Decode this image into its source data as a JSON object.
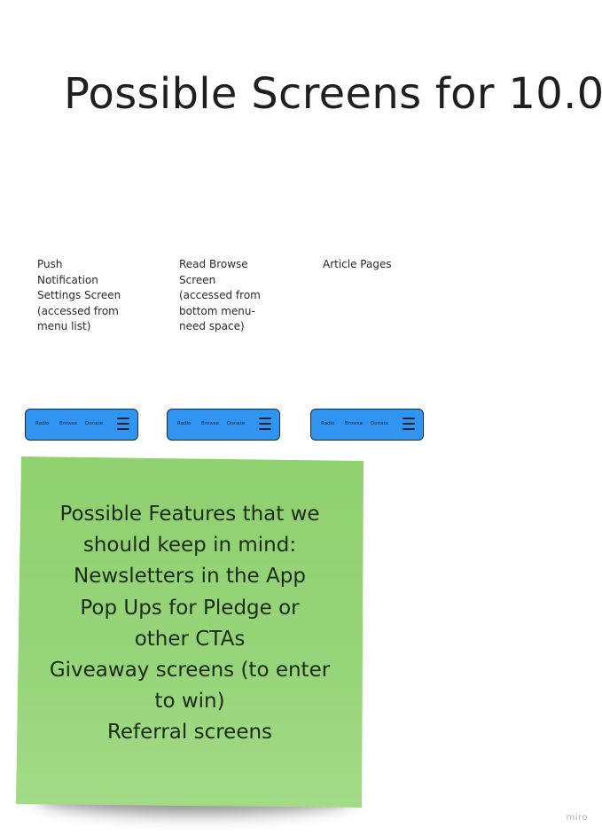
{
  "board": {
    "title": "Possible Screens for  10.0"
  },
  "screens": [
    {
      "label_lines": [
        "Push",
        "Notification",
        "Settings Screen",
        "(accessed from",
        "menu list)"
      ],
      "nav": {
        "items": [
          "Radio",
          "Browse",
          "Donate"
        ],
        "menu_icon": "hamburger-icon"
      }
    },
    {
      "label_lines": [
        "Read Browse",
        "Screen",
        "(accessed from",
        "bottom menu-",
        "need space)"
      ],
      "nav": {
        "items": [
          "Radio",
          "Browse",
          "Donate"
        ],
        "menu_icon": "hamburger-icon"
      }
    },
    {
      "label_lines": [
        "Article Pages"
      ],
      "nav": {
        "items": [
          "Radio",
          "Browse",
          "Donate"
        ],
        "menu_icon": "hamburger-icon"
      }
    }
  ],
  "sticky_note": {
    "color": "#97d57a",
    "lines": [
      "Possible Features that we",
      "should keep in mind:",
      "Newsletters in the App",
      "Pop Ups for Pledge or",
      "other CTAs",
      "Giveaway screens (to enter",
      "to win)",
      "Referral screens"
    ]
  },
  "colors": {
    "nav_bar": "#2f95f0",
    "background": "#ffffff"
  },
  "watermark": "miro"
}
